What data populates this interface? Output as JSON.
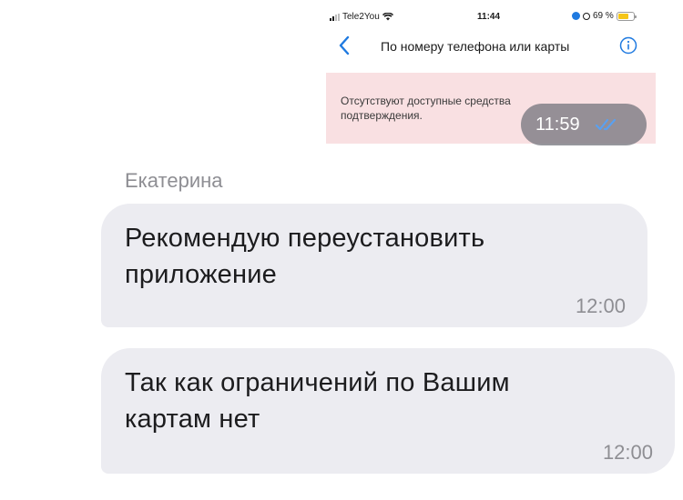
{
  "embedded_screenshot": {
    "status_bar": {
      "carrier": "Tele2You",
      "time": "11:44",
      "battery": "69 %",
      "battery_level": 0.69
    },
    "nav": {
      "title": "По номеру телефона или карты",
      "back_icon": "chevron-left-icon",
      "info_icon": "info-icon"
    },
    "alert": {
      "text": "Отсутствуют доступные средства подтверждения."
    },
    "colors": {
      "accent": "#1f7ae0",
      "alert_bg": "#f9e0e2"
    }
  },
  "image_message": {
    "time": "11:59",
    "status_icon": "double-check-icon"
  },
  "messages": [
    {
      "sender": "Екатерина",
      "text": "Рекомендую переустановить\nприложение",
      "time": "12:00"
    },
    {
      "text": "Так как ограничений по Вашим\nкартам нет",
      "time": "12:00"
    }
  ],
  "colors": {
    "bubble_bg": "#ececf1",
    "meta_text": "#8e8e93",
    "read_check": "#5aa0f0"
  }
}
